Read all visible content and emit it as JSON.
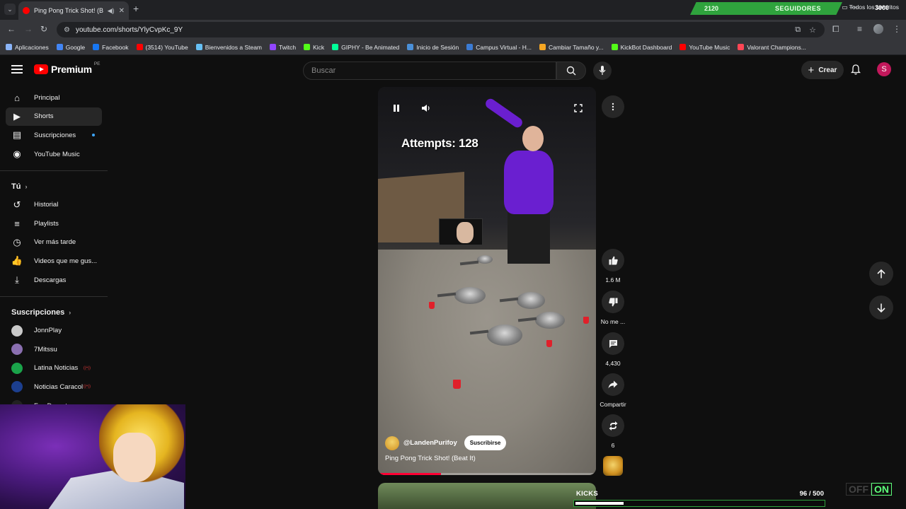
{
  "browser": {
    "tab_title": "Ping Pong Trick Shot! (Beat",
    "url": "youtube.com/shorts/YlyCvpKc_9Y",
    "bookmarks": [
      {
        "label": "Aplicaciones",
        "color": "#8ab4f8"
      },
      {
        "label": "Google",
        "color": "#4285f4"
      },
      {
        "label": "Facebook",
        "color": "#1877f2"
      },
      {
        "label": "(3514) YouTube",
        "color": "#ff0000"
      },
      {
        "label": "Bienvenidos a Steam",
        "color": "#66c0f4"
      },
      {
        "label": "Twitch",
        "color": "#9146ff"
      },
      {
        "label": "Kick",
        "color": "#53fc18"
      },
      {
        "label": "GIPHY - Be Animated",
        "color": "#00ff99"
      },
      {
        "label": "Inicio de Sesión",
        "color": "#4a90d9"
      },
      {
        "label": "Campus Virtual - H...",
        "color": "#3b7bd4"
      },
      {
        "label": "Cambiar Tamaño y...",
        "color": "#f5a623"
      },
      {
        "label": "KickBot Dashboard",
        "color": "#53fc18"
      },
      {
        "label": "YouTube Music",
        "color": "#ff0000"
      },
      {
        "label": "Valorant Champions...",
        "color": "#ff4655"
      }
    ],
    "all_bookmarks": "Todos los favoritos"
  },
  "stream_overlay": {
    "followers_count": "2120",
    "followers_label": "SEGUIDORES",
    "followers_goal": "3000",
    "kicks_label": "KICKS",
    "kicks_current": "96",
    "kicks_separator": "/",
    "kicks_goal": "500",
    "kicks_progress": 0.192,
    "toggle_off": "OFF",
    "toggle_on": "ON"
  },
  "youtube": {
    "logo_text": "Premium",
    "country_code": "PE",
    "search_placeholder": "Buscar",
    "create_label": "Crear",
    "avatar_letter": "S",
    "sidebar_main": [
      {
        "label": "Principal",
        "icon": "home-icon"
      },
      {
        "label": "Shorts",
        "icon": "shorts-icon",
        "active": true
      },
      {
        "label": "Suscripciones",
        "icon": "subscriptions-icon",
        "new": true
      },
      {
        "label": "YouTube Music",
        "icon": "youtube-music-icon"
      }
    ],
    "you_heading": "Tú",
    "sidebar_you": [
      {
        "label": "Historial",
        "icon": "history-icon"
      },
      {
        "label": "Playlists",
        "icon": "playlists-icon"
      },
      {
        "label": "Ver más tarde",
        "icon": "watch-later-icon"
      },
      {
        "label": "Videos que me gus...",
        "icon": "liked-videos-icon"
      },
      {
        "label": "Descargas",
        "icon": "downloads-icon"
      }
    ],
    "subs_heading": "Suscripciones",
    "subscriptions": [
      {
        "label": "JonnPlay",
        "color": "#c9c9c9"
      },
      {
        "label": "7Mitssu",
        "color": "#8a6fb0"
      },
      {
        "label": "Latina Noticias",
        "color": "#1aa34a",
        "live": true
      },
      {
        "label": "Noticias Caracol",
        "color": "#1c3f8f",
        "live": true
      },
      {
        "label": "Fox Deportes",
        "color": "#222222"
      }
    ]
  },
  "short": {
    "overlay_text": "Attempts: 128",
    "channel": "@LandenPurifoy",
    "subscribe_label": "Suscribirse",
    "title": "Ping Pong Trick Shot! (Beat It)",
    "progress": 0.29,
    "likes": "1.6 M",
    "dislike_label": "No me ...",
    "comments": "4,430",
    "share_label": "Compartir",
    "remix_count": "6"
  }
}
